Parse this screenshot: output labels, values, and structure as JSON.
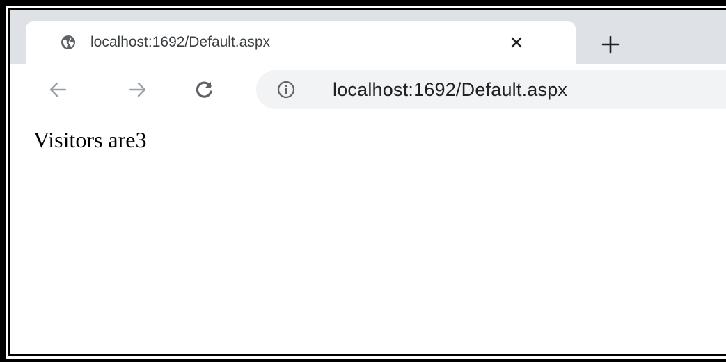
{
  "browser": {
    "tab": {
      "title": "localhost:1692/Default.aspx",
      "favicon": "globe-icon",
      "close_icon": "close-icon"
    },
    "new_tab_icon": "plus-icon",
    "toolbar": {
      "back_icon": "back-arrow-icon",
      "forward_icon": "forward-arrow-icon",
      "reload_icon": "reload-icon",
      "site_info_icon": "info-icon",
      "url": "localhost:1692/Default.aspx"
    }
  },
  "page": {
    "text": "Visitors are3"
  },
  "colors": {
    "tab_strip": "#dee1e6",
    "omnibox": "#f1f3f4",
    "icon": "#5f6368",
    "disabled_icon": "#9aa0a6"
  }
}
